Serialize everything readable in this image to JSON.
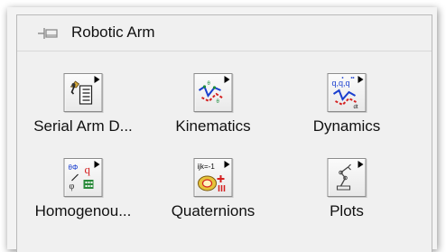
{
  "palette": {
    "title": "Robotic Arm",
    "items": [
      {
        "label": "Serial Arm D...",
        "icon": "serial-arm-icon"
      },
      {
        "label": "Kinematics",
        "icon": "kinematics-icon"
      },
      {
        "label": "Dynamics",
        "icon": "dynamics-icon"
      },
      {
        "label": "Homogenou...",
        "icon": "homogeneous-icon"
      },
      {
        "label": "Quaternions",
        "icon": "quaternions-icon",
        "glyph": "ijk=-1"
      },
      {
        "label": "Plots",
        "icon": "plots-icon"
      }
    ]
  }
}
